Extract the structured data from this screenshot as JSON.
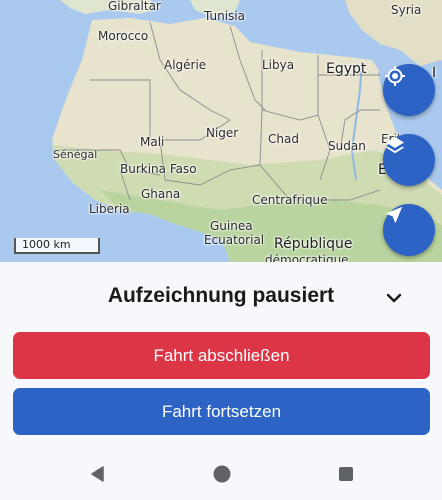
{
  "map": {
    "labels": {
      "gibraltar": "Gibraltar",
      "tunisia": "Tunisia",
      "syria": "Syria",
      "morocco": "Morocco",
      "algerie": "Algérie",
      "libya": "Libya",
      "egypt": "Egypt",
      "mali": "Mali",
      "niger": "Niger",
      "chad": "Chad",
      "sudan": "Sudan",
      "senegal": "Sénégal",
      "burkina_faso": "Burkina Faso",
      "ghana": "Ghana",
      "liberia": "Liberia",
      "centrafrique": "Centrafrique",
      "guinea_ecuatorial_1": "Guinea",
      "guinea_ecuatorial_2": "Ecuatorial",
      "rdc_1": "République",
      "rdc_2": "démocratique",
      "eritrea_partial": "Erit",
      "ethiopia_partial": "E",
      "iraq_partial": "I"
    },
    "scale_label": "1000 km",
    "colors": {
      "water": "#a9c9ee",
      "desert": "#e7e3cf",
      "green": "#c8dcae",
      "border": "#8c8c8c"
    }
  },
  "fabs": {
    "locate_icon": "my-location-icon",
    "layers_icon": "layers-icon",
    "navigation_icon": "navigation-arrow-icon"
  },
  "sheet": {
    "title": "Aufzeichnung pausiert",
    "collapse_icon": "chevron-down-icon",
    "finish_label": "Fahrt abschließen",
    "continue_label": "Fahrt fortsetzen",
    "colors": {
      "finish": "#dc3545",
      "continue": "#2c63c4"
    }
  },
  "system_nav": {
    "back_icon": "back-triangle-icon",
    "home_icon": "home-circle-icon",
    "recent_icon": "recent-square-icon"
  }
}
